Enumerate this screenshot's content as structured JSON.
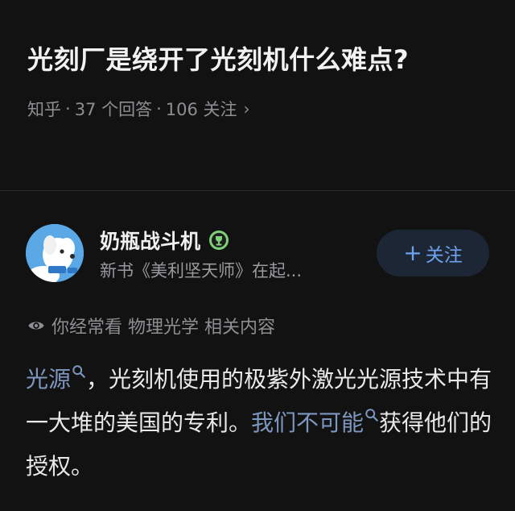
{
  "question": {
    "title": "光刻厂是绕开了光刻机什么难点?",
    "source": "知乎",
    "answers": "37 个回答",
    "follows": "106 关注"
  },
  "author": {
    "name": "奶瓶战斗机",
    "description": "新书《美利坚天师》在起...",
    "follow_label": "关注",
    "follow_plus": "+"
  },
  "recommend_reason": "你经常看 物理光学 相关内容",
  "answer": {
    "keyword_1": "光源",
    "text_1": "，光刻机使用的极紫外激光光源技术中有一大堆的美国的专利。",
    "keyword_2": "我们不可能",
    "text_2": "获得他们的授权。"
  },
  "colors": {
    "background": "#121212",
    "keyword": "#7d97bf",
    "follow_text": "#6ea2ee",
    "follow_bg": "#1d2635",
    "badge": "#7ed07a"
  },
  "icons": {
    "meta_arrow": "chevron-right-icon",
    "badge": "trophy-badge-icon",
    "reason": "eye-icon",
    "keyword": "search-icon"
  }
}
